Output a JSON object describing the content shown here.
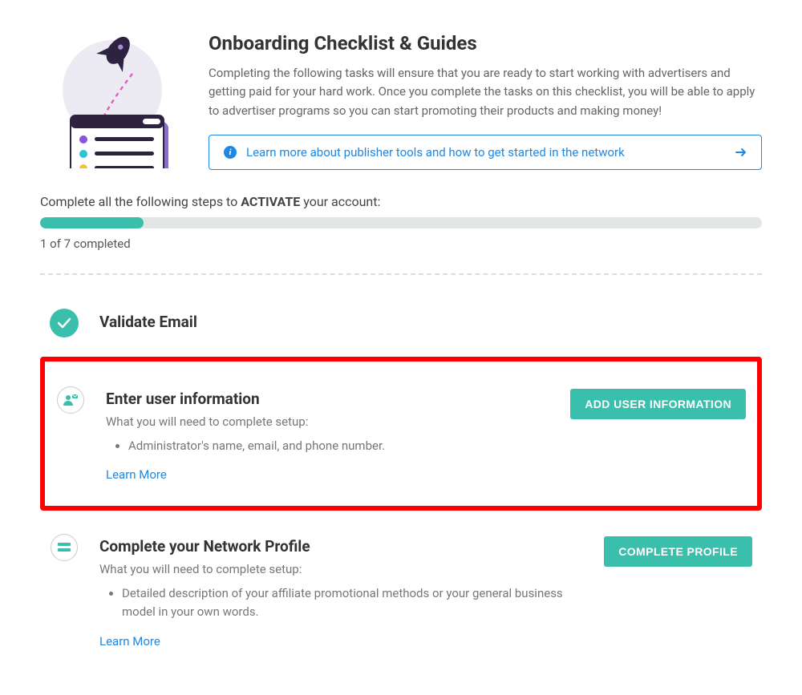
{
  "header": {
    "title": "Onboarding Checklist & Guides",
    "description": "Completing the following tasks will ensure that you are ready to start working with advertisers and getting paid for your hard work. Once you complete the tasks on this checklist, you will be able to apply to advertiser programs so you can start promoting their products and making money!",
    "learn_link": "Learn more about publisher tools and how to get started in the network"
  },
  "progress": {
    "instructions_pre": "Complete all the following steps to ",
    "instructions_bold": "ACTIVATE",
    "instructions_post": " your account:",
    "completed": 1,
    "total": 7,
    "label": "1 of 7 completed",
    "percent": 14.3
  },
  "steps": [
    {
      "title": "Validate Email",
      "completed": true
    },
    {
      "title": "Enter user information",
      "subtitle": "What you will need to complete setup:",
      "items": [
        "Administrator's name, email, and phone number."
      ],
      "learn_more": "Learn More",
      "action_label": "ADD USER INFORMATION",
      "completed": false,
      "highlighted": true
    },
    {
      "title": "Complete your Network Profile",
      "subtitle": "What you will need to complete setup:",
      "items": [
        "Detailed description of your affiliate promotional methods or your general business model in your own words."
      ],
      "learn_more": "Learn More",
      "action_label": "COMPLETE PROFILE",
      "completed": false
    }
  ]
}
